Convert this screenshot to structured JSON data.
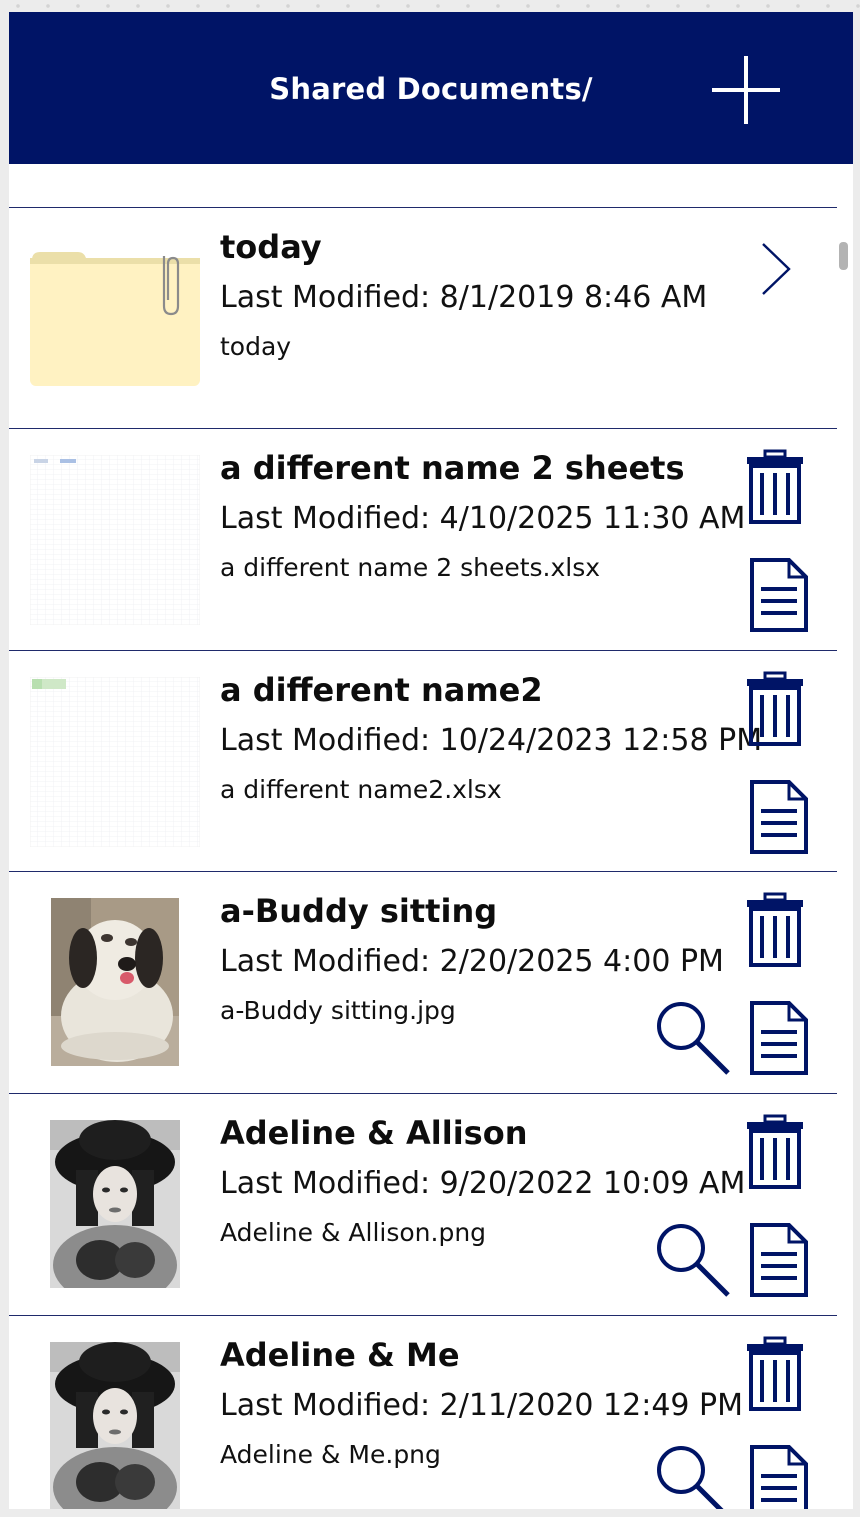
{
  "header": {
    "title": "Shared Documents/",
    "add_icon": "plus-icon"
  },
  "colors": {
    "header_bg": "#001466",
    "icon_color": "#001466",
    "folder_fill": "#fff2c2"
  },
  "items": [
    {
      "type": "folder",
      "title": "today",
      "modified": "Last Modified: 8/1/2019 8:46 AM",
      "filename": "today",
      "thumbnail": "folder-icon",
      "actions": [
        "chevron-right-icon"
      ]
    },
    {
      "type": "file",
      "title": "a different name 2 sheets",
      "modified": "Last Modified: 4/10/2025 11:30 AM",
      "filename": "a different name 2 sheets.xlsx",
      "thumbnail": "spreadsheet-thumbnail",
      "actions": [
        "trash-icon",
        "document-icon"
      ]
    },
    {
      "type": "file",
      "title": "a different name2",
      "modified": "Last Modified: 10/24/2023 12:58 PM",
      "filename": "a different name2.xlsx",
      "thumbnail": "spreadsheet-thumbnail",
      "actions": [
        "trash-icon",
        "document-icon"
      ]
    },
    {
      "type": "image",
      "title": "a-Buddy sitting",
      "modified": "Last Modified: 2/20/2025 4:00 PM",
      "filename": "a-Buddy sitting.jpg",
      "thumbnail": "dog-photo",
      "actions": [
        "trash-icon",
        "magnifier-icon",
        "document-icon"
      ]
    },
    {
      "type": "image",
      "title": "Adeline & Allison",
      "modified": "Last Modified: 9/20/2022 10:09 AM",
      "filename": "Adeline & Allison.png",
      "thumbnail": "portrait-photo",
      "actions": [
        "trash-icon",
        "magnifier-icon",
        "document-icon"
      ]
    },
    {
      "type": "image",
      "title": "Adeline & Me",
      "modified": "Last Modified: 2/11/2020 12:49 PM",
      "filename": "Adeline & Me.png",
      "thumbnail": "portrait-photo",
      "actions": [
        "trash-icon",
        "magnifier-icon",
        "document-icon"
      ]
    }
  ]
}
